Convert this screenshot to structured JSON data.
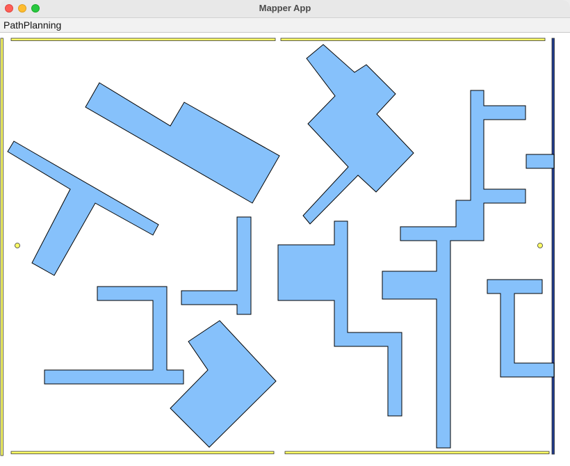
{
  "window": {
    "title": "Mapper App"
  },
  "menubar": {
    "items": [
      {
        "label": "PathPlanning"
      }
    ]
  },
  "colors": {
    "obstacle_fill": "#86c1fb",
    "obstacle_stroke": "#000000",
    "wall_fill": "#ffff66",
    "wall_stroke": "#333333",
    "wall_right_fill": "#1e3a8a",
    "waypoint_fill": "#ffff66",
    "canvas_background": "#ffffff"
  },
  "map": {
    "obstacle_count": 12,
    "wall_count": 6,
    "waypoint_count": 2
  }
}
